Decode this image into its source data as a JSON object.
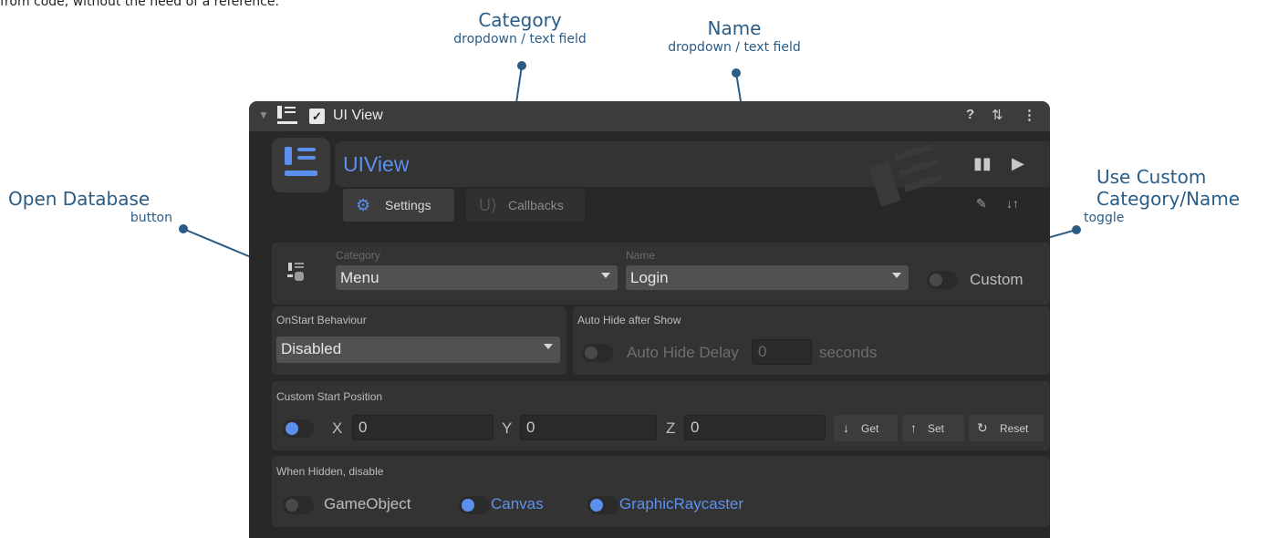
{
  "intro_text": "from code, without the need of a reference.",
  "annotations": {
    "category": {
      "title": "Category",
      "subtitle": "dropdown / text field"
    },
    "name": {
      "title": "Name",
      "subtitle": "dropdown / text field"
    },
    "open_database": {
      "title": "Open Database",
      "subtitle": "button"
    },
    "custom": {
      "title_line1": "Use Custom",
      "title_line2": "Category/Name",
      "subtitle": "toggle"
    }
  },
  "component": {
    "title": "UI View",
    "enabled": true,
    "header_name": "UIView",
    "tabs": [
      {
        "label": "Settings",
        "icon": "gear-icon",
        "selected": true
      },
      {
        "label": "Callbacks",
        "icon": "callbacks-icon",
        "selected": false
      }
    ]
  },
  "id_section": {
    "category_label": "Category",
    "category_value": "Menu",
    "name_label": "Name",
    "name_value": "Login",
    "custom_label": "Custom",
    "custom_on": false
  },
  "onstart": {
    "label": "OnStart Behaviour",
    "value": "Disabled"
  },
  "auto_hide": {
    "label": "Auto Hide after Show",
    "toggle_on": false,
    "delay_label": "Auto Hide Delay",
    "delay_value": "0",
    "unit": "seconds"
  },
  "start_position": {
    "label": "Custom Start Position",
    "toggle_on": true,
    "x_label": "X",
    "x_value": "0",
    "y_label": "Y",
    "y_value": "0",
    "z_label": "Z",
    "z_value": "0",
    "get_label": "Get",
    "set_label": "Set",
    "reset_label": "Reset"
  },
  "when_hidden": {
    "label": "When Hidden, disable",
    "items": [
      {
        "label": "GameObject",
        "on": false
      },
      {
        "label": "Canvas",
        "on": true
      },
      {
        "label": "GraphicRaycaster",
        "on": true
      }
    ]
  },
  "colors": {
    "accent": "#5b8ff0",
    "annotation": "#2a5c86",
    "panel_bg": "#282828",
    "section_bg": "#333333"
  }
}
